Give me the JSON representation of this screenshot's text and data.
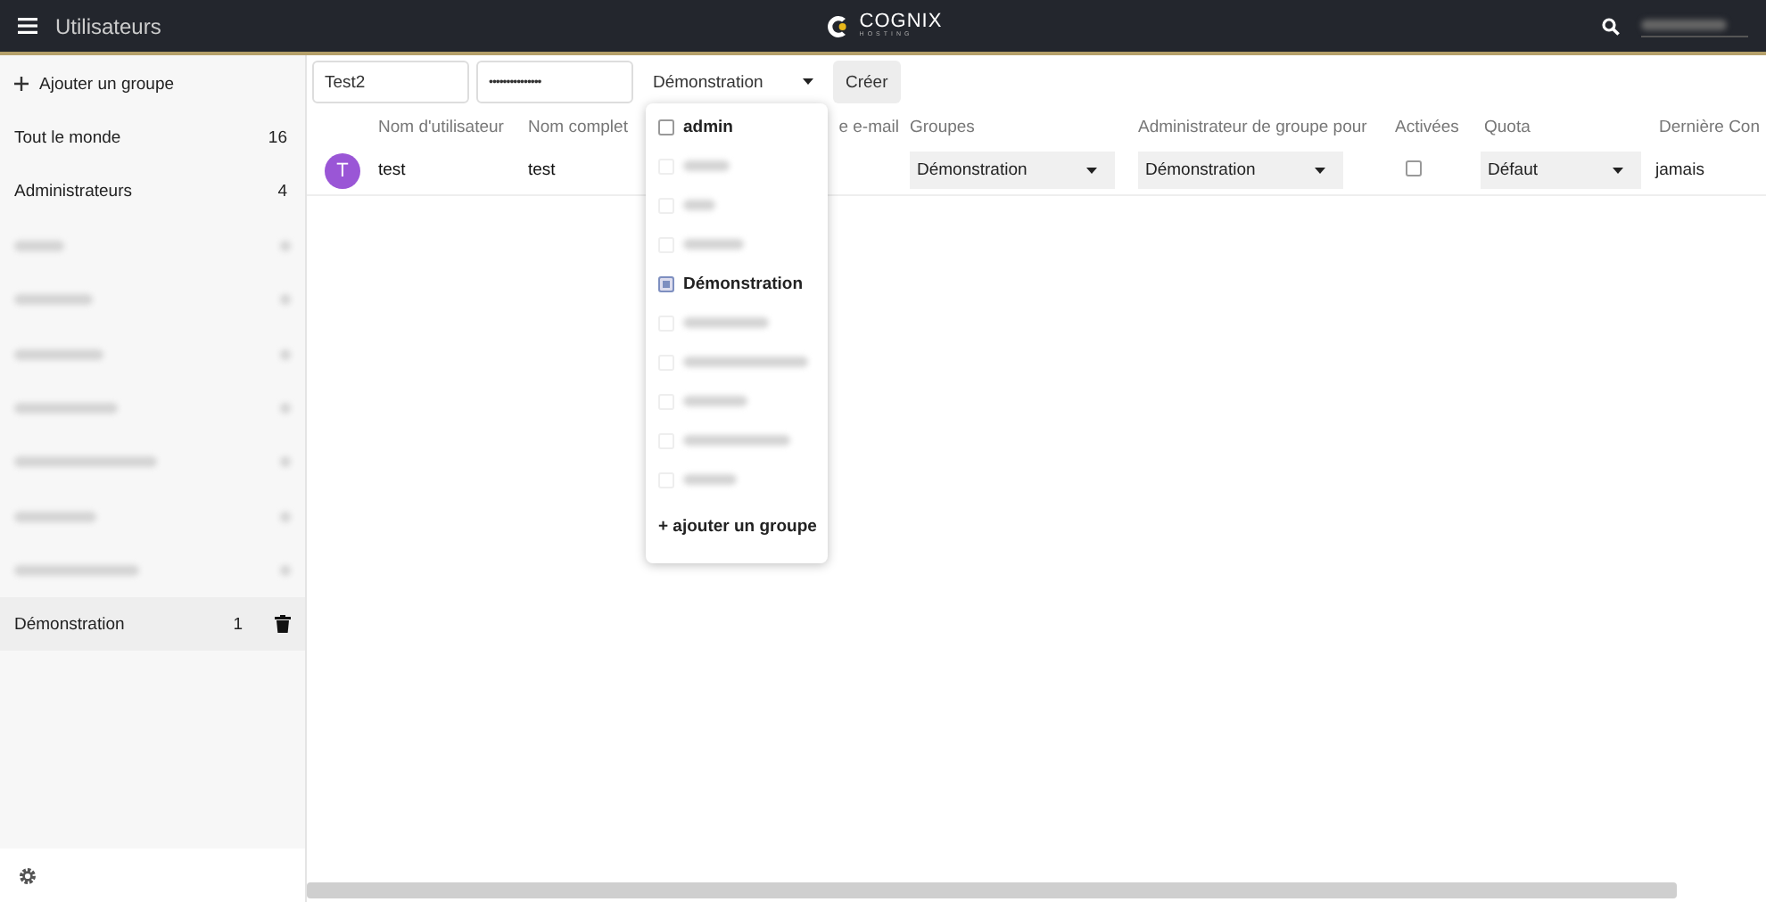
{
  "header": {
    "title": "Utilisateurs",
    "logo": {
      "name": "COGNIX",
      "tagline": "HOSTING"
    },
    "account": {
      "kind": "blurred"
    }
  },
  "sidebar": {
    "add_group": "Ajouter un groupe",
    "items": [
      {
        "kind": "text",
        "label": "Tout le monde",
        "count": "16",
        "selected": false
      },
      {
        "kind": "text",
        "label": "Administrateurs",
        "count": "4",
        "selected": false
      },
      {
        "kind": "blurred",
        "selected": false
      },
      {
        "kind": "blurred",
        "selected": false
      },
      {
        "kind": "blurred",
        "selected": false
      },
      {
        "kind": "blurred",
        "selected": false
      },
      {
        "kind": "blurred",
        "selected": false
      },
      {
        "kind": "blurred",
        "selected": false
      },
      {
        "kind": "blurred",
        "selected": false
      },
      {
        "kind": "text",
        "label": "Démonstration",
        "count": "1",
        "selected": true
      }
    ]
  },
  "new_user": {
    "username": "Test2",
    "password": "•••••••••••••••",
    "group_select": "Démonstration",
    "create": "Créer"
  },
  "group_dropdown": {
    "options": [
      {
        "kind": "text",
        "label": "admin",
        "checked": false
      },
      {
        "kind": "blurred",
        "checked": false
      },
      {
        "kind": "blurred",
        "checked": false
      },
      {
        "kind": "blurred",
        "checked": false
      },
      {
        "kind": "text",
        "label": "Démonstration",
        "checked": true
      },
      {
        "kind": "blurred",
        "checked": false
      },
      {
        "kind": "blurred",
        "checked": false
      },
      {
        "kind": "blurred",
        "checked": false
      },
      {
        "kind": "blurred",
        "checked": false
      },
      {
        "kind": "blurred",
        "checked": false
      }
    ],
    "add": "+ ajouter un groupe"
  },
  "table": {
    "columns": [
      "Nom d'utilisateur",
      "Nom complet",
      "e e-mail",
      "Groupes",
      "Administrateur de groupe pour",
      "Activées",
      "Quota",
      "Dernière Con"
    ],
    "rows": [
      {
        "avatar": "T",
        "username": "test",
        "full_name": "test",
        "groups": "Démonstration",
        "admin_for": "Démonstration",
        "enabled": false,
        "quota": "Défaut",
        "last_login": "jamais"
      }
    ]
  }
}
